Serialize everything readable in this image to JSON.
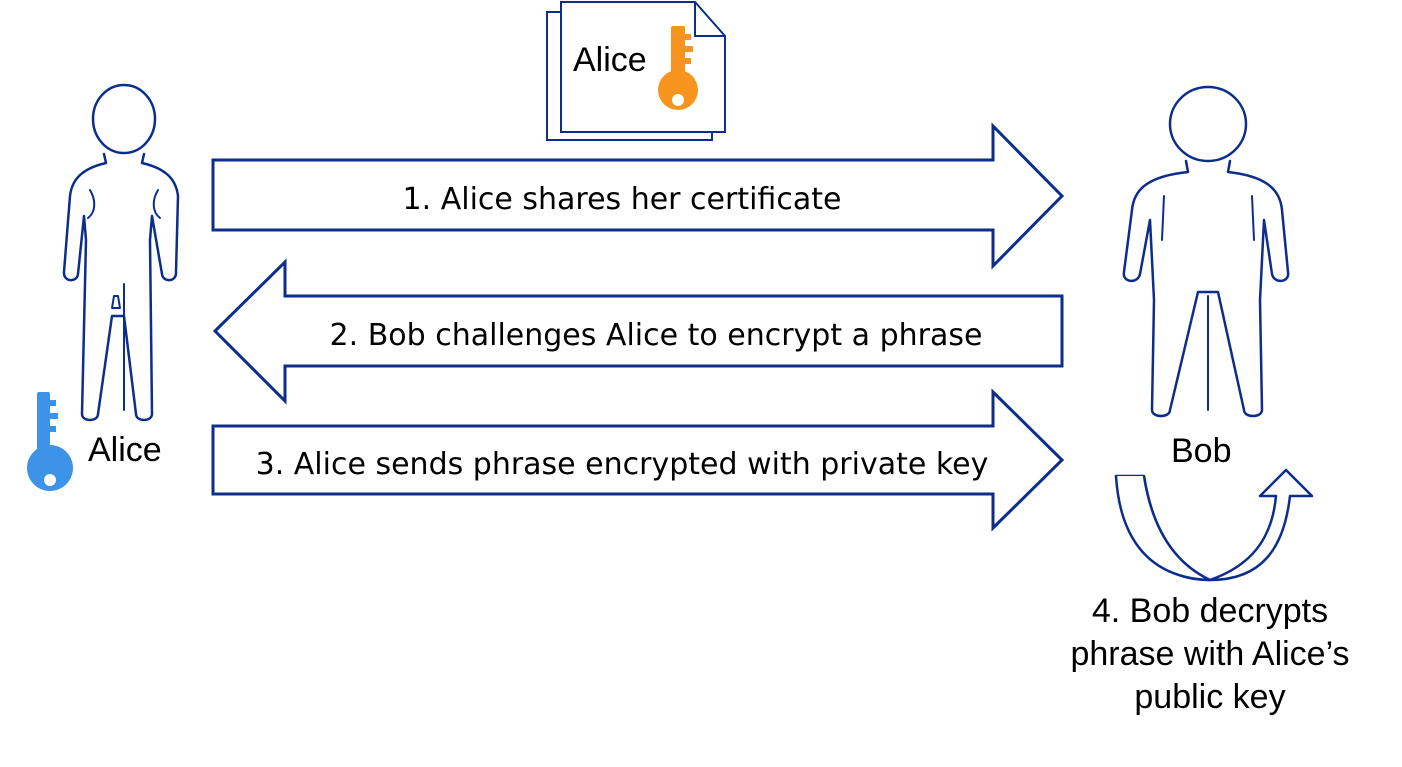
{
  "certificate": {
    "owner_label": "Alice",
    "key_icon": "orange-key-icon",
    "key_color": "#f7941d"
  },
  "people": {
    "alice": {
      "name": "Alice",
      "icon": "woman-figure-icon",
      "private_key_color": "#3d93e8"
    },
    "bob": {
      "name": "Bob",
      "icon": "man-figure-icon"
    }
  },
  "steps": [
    {
      "number": 1,
      "text": "1. Alice shares her certificate",
      "direction": "right"
    },
    {
      "number": 2,
      "text": "2. Bob challenges Alice to encrypt a phrase",
      "direction": "left"
    },
    {
      "number": 3,
      "text": "3. Alice sends phrase encrypted with private key",
      "direction": "right"
    },
    {
      "number": 4,
      "lines": [
        "4. Bob decrypts",
        "phrase with Alice’s",
        "public key"
      ]
    }
  ],
  "colors": {
    "outline": "#0c2e8a",
    "uturn_fill": "#d0d0d0",
    "text": "#000000"
  }
}
